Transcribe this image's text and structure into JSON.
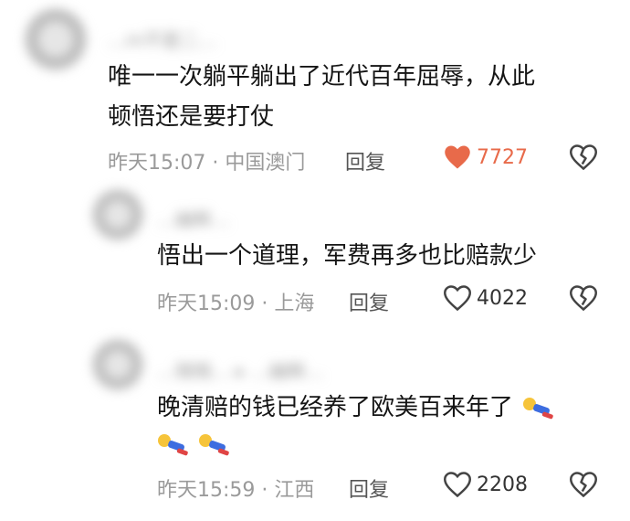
{
  "comments": [
    {
      "username": "…m不是二…",
      "text_line1": "唯一一次躺平躺出了近代百年屈辱，从此",
      "text_line2": "顿悟还是要打仗",
      "time": "昨天15:07",
      "location": "中国澳门",
      "reply_label": "回复",
      "likes": "7727",
      "liked": true
    },
    {
      "username": "…幽眸…",
      "text_line1": "悟出一个道理，军费再多也比赔款少",
      "time": "昨天15:09",
      "location": "上海",
      "reply_label": "回复",
      "likes": "4022",
      "liked": false
    },
    {
      "username": "…晓晓… ▸ …幽眸…",
      "text_line1": "晚清赔的钱已经养了欧美百来年了",
      "time": "昨天15:59",
      "location": "江西",
      "reply_label": "回复",
      "likes": "2208",
      "liked": false
    }
  ],
  "meta_separator": "·",
  "icons": {
    "like": "heart-icon",
    "dislike": "broken-heart-icon",
    "emoji": "lying-flat-emoji-icon"
  },
  "colors": {
    "like_active": "#e86a4a",
    "meta": "#9a9a9a"
  }
}
